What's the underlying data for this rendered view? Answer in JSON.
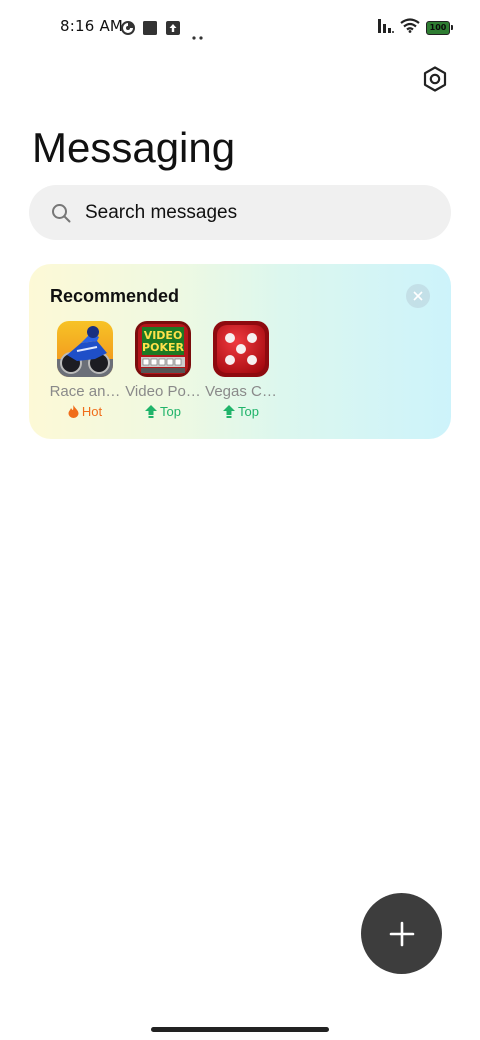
{
  "status": {
    "time": "8:16 AM",
    "battery": "100"
  },
  "header": {
    "title": "Messaging"
  },
  "search": {
    "placeholder": "Search messages"
  },
  "recommended": {
    "title": "Recommended",
    "apps": [
      {
        "name": "Race an…",
        "badge": "Hot",
        "badge_color": "#f06d1a"
      },
      {
        "name": "Video Po…",
        "badge": "Top",
        "badge_color": "#20b46a"
      },
      {
        "name": "Vegas C…",
        "badge": "Top",
        "badge_color": "#20b46a"
      }
    ],
    "video_poker_icon_text": [
      "VIDEO",
      "POKER"
    ]
  },
  "colors": {
    "fab": "#3d3d3d",
    "search_bg": "#f0f0f0",
    "hot": "#f06d1a",
    "top": "#20b46a"
  }
}
